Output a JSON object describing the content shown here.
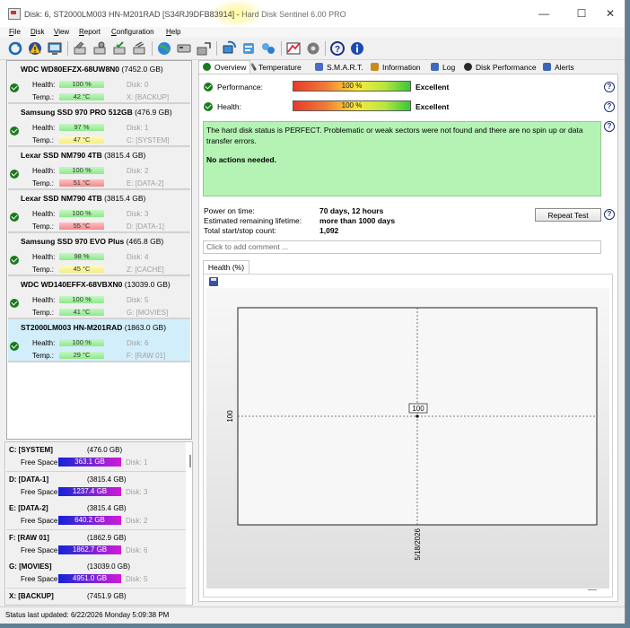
{
  "window": {
    "title": "Disk: 6, ST2000LM003 HN-M201RAD [S34RJ9DFB83914]",
    "title_sep": "  -  ",
    "app_name": "Hard Disk Sentinel 6.00 PRO",
    "minimize": "—",
    "maximize": "☐",
    "close": "✕"
  },
  "menu": [
    {
      "u": "F",
      "rest": "ile"
    },
    {
      "u": "D",
      "rest": "isk"
    },
    {
      "u": "V",
      "rest": "iew"
    },
    {
      "u": "R",
      "rest": "eport"
    },
    {
      "u": "C",
      "rest": "onfiguration"
    },
    {
      "u": "H",
      "rest": "elp"
    }
  ],
  "toolbar_icons": [
    "refresh-icon",
    "alert-icon",
    "monitor-icon",
    "disk-tool-icon",
    "disk-gear-icon",
    "disk-check-icon",
    "disk-settings-icon",
    "globe-icon",
    "device-icon",
    "export-icon",
    "sync-icon",
    "network-icon",
    "chart-icon",
    "options-icon",
    "help-icon",
    "info-icon"
  ],
  "disks": [
    {
      "name": "WDC WD80EFZX-68UW8N0",
      "cap": "(7452.0 GB)",
      "health_label": "Health:",
      "temp_label": "Temp.:",
      "health": "100 %",
      "health_color": "green",
      "temp": "42 °C",
      "temp_color": "green",
      "disk_no": "Disk: 0",
      "vol": "X: [BACKUP]",
      "selected": false
    },
    {
      "name": "Samsung SSD 970 PRO 512GB",
      "cap": "(476.9 GB)",
      "health_label": "Health:",
      "temp_label": "Temp.:",
      "health": "97 %",
      "health_color": "green",
      "temp": "47 °C",
      "temp_color": "yellow",
      "disk_no": "Disk: 1",
      "vol": "C: [SYSTEM]",
      "selected": false
    },
    {
      "name": "Lexar SSD NM790 4TB",
      "cap": "(3815.4 GB)",
      "health_label": "Health:",
      "temp_label": "Temp.:",
      "health": "100 %",
      "health_color": "green",
      "temp": "51 °C",
      "temp_color": "red",
      "disk_no": "Disk: 2",
      "vol": "E: [DATA-2]",
      "selected": false
    },
    {
      "name": "Lexar SSD NM790 4TB",
      "cap": "(3815.4 GB)",
      "health_label": "Health:",
      "temp_label": "Temp.:",
      "health": "100 %",
      "health_color": "green",
      "temp": "55 °C",
      "temp_color": "red",
      "disk_no": "Disk: 3",
      "vol": "D: [DATA-1]",
      "selected": false
    },
    {
      "name": "Samsung SSD 970 EVO Plus",
      "cap": "(465.8 GB)",
      "health_label": "Health:",
      "temp_label": "Temp.:",
      "health": "98 %",
      "health_color": "green",
      "temp": "45 °C",
      "temp_color": "yellow",
      "disk_no": "Disk: 4",
      "vol": "Z: [CACHE]",
      "selected": false
    },
    {
      "name": "WDC WD140EFFX-68VBXN0",
      "cap": "(13039.0 GB)",
      "health_label": "Health:",
      "temp_label": "Temp.:",
      "health": "100 %",
      "health_color": "green",
      "temp": "41 °C",
      "temp_color": "green",
      "disk_no": "Disk: 5",
      "vol": "G: [MOVIES]",
      "selected": false
    },
    {
      "name": "ST2000LM003 HN-M201RAD",
      "cap": "(1863.0 GB)",
      "health_label": "Health:",
      "temp_label": "Temp.:",
      "health": "100 %",
      "health_color": "green",
      "temp": "29 °C",
      "temp_color": "green",
      "disk_no": "Disk: 6",
      "vol": "F: [RAW 01]",
      "selected": true
    }
  ],
  "volumes": [
    {
      "name": "C: [SYSTEM]",
      "cap": "(476.0 GB)",
      "free_label": "Free Space",
      "free": "363.1 GB",
      "disk": "Disk: 1",
      "free_fraction": 0.76
    },
    {
      "name": "D: [DATA-1]",
      "cap": "(3815.4 GB)",
      "free_label": "Free Space",
      "free": "1237.4 GB",
      "disk": "Disk: 3",
      "free_fraction": 0.32
    },
    {
      "name": "E: [DATA-2]",
      "cap": "(3815.4 GB)",
      "free_label": "Free Space",
      "free": "640.2 GB",
      "disk": "Disk: 2",
      "free_fraction": 0.17
    },
    {
      "name": "F: [RAW 01]",
      "cap": "(1862.9 GB)",
      "free_label": "Free Space",
      "free": "1862.7 GB",
      "disk": "Disk: 6",
      "free_fraction": 1.0
    },
    {
      "name": "G: [MOVIES]",
      "cap": "(13039.0 GB)",
      "free_label": "Free Space",
      "free": "4951.0 GB",
      "disk": "Disk: 5",
      "free_fraction": 0.38
    },
    {
      "name": "X: [BACKUP]",
      "cap": "(7451.9 GB)",
      "free_label": "",
      "free": "",
      "disk": "",
      "free_fraction": null
    }
  ],
  "status_bar": "Status last updated: 6/22/2026 Monday 5:09:38 PM",
  "tabs": [
    {
      "label": "Overview",
      "icon": "check-icon",
      "active": true
    },
    {
      "label": "Temperature",
      "icon": "thermometer-icon",
      "active": false
    },
    {
      "label": "S.M.A.R.T.",
      "icon": "smart-icon",
      "active": false
    },
    {
      "label": "Information",
      "icon": "information-icon",
      "active": false
    },
    {
      "label": "Log",
      "icon": "log-icon",
      "active": false
    },
    {
      "label": "Disk Performance",
      "icon": "performance-icon",
      "active": false
    },
    {
      "label": "Alerts",
      "icon": "alerts-icon",
      "active": false
    }
  ],
  "overview": {
    "performance_label": "Performance:",
    "performance_value": "100 %",
    "performance_rating": "Excellent",
    "health_label": "Health:",
    "health_value": "100 %",
    "health_rating": "Excellent",
    "status_message": "The hard disk status is PERFECT. Problematic or weak sectors were not found and there are no spin up or data transfer errors.",
    "actions": "No actions needed.",
    "power_on_label": "Power on time:",
    "power_on_value": "70 days, 12 hours",
    "lifetime_label": "Estimated remaining lifetime:",
    "lifetime_value": "more than 1000 days",
    "startstop_label": "Total start/stop count:",
    "startstop_value": "1,092",
    "repeat_button": "Repeat Test",
    "comment_placeholder": "Click to add comment ...",
    "help": "?"
  },
  "health_tab_label": "Health (%)",
  "chart_data": {
    "type": "line",
    "title": "",
    "xlabel": "",
    "ylabel": "",
    "x": [
      "5/18/2026"
    ],
    "series": [
      {
        "values": [
          100
        ]
      }
    ],
    "y_tick_labels": [
      "100"
    ],
    "x_tick_labels": [
      "5/18/2026"
    ],
    "data_labels": [
      "100"
    ],
    "grid": true
  },
  "colors": {
    "excellent_green": "#b4f3b4",
    "selected_disk": "#d3eefb",
    "ok_green": "#1a7a1f"
  }
}
